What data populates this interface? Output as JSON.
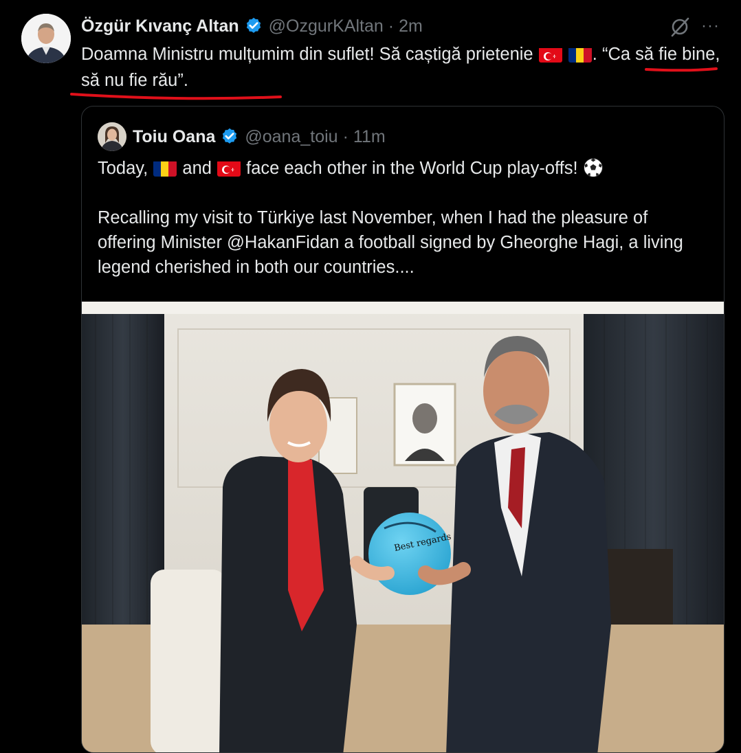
{
  "tweet": {
    "author_name": "Özgür Kıvanç Altan",
    "handle": "@OzgurKAltan",
    "separator": "·",
    "time": "2m",
    "more_label": "···",
    "text_part1": "Doamna Ministru mulțumim din suflet! Să caștigă prietenie ",
    "text_part2": ". “Ca să fie bine, să nu fie rău”."
  },
  "quote": {
    "author_name": "Toiu Oana",
    "handle": "@oana_toiu",
    "separator": "·",
    "time": "11m",
    "line1_a": "Today, ",
    "line1_b": " and ",
    "line1_c": " face each other in the World Cup play-offs! ",
    "paragraph2": "Recalling my visit to Türkiye last November, when I had the pleasure of offering Minister @HakanFidan a football signed by Gheorghe Hagi, a living legend cherished in both our countries....",
    "ball_signature": "Best regards"
  },
  "icons": {
    "verified": "verified-badge-icon",
    "grok": "grok-icon",
    "more": "more-icon",
    "flag_tr": "turkey-flag-icon",
    "flag_ro": "romania-flag-icon",
    "soccer": "soccer-ball-icon"
  },
  "colors": {
    "background": "#000000",
    "text": "#e7e9ea",
    "muted": "#71767b",
    "verified": "#1d9bf0",
    "annotation": "#e0101a",
    "ball": "#3ab8e0"
  }
}
